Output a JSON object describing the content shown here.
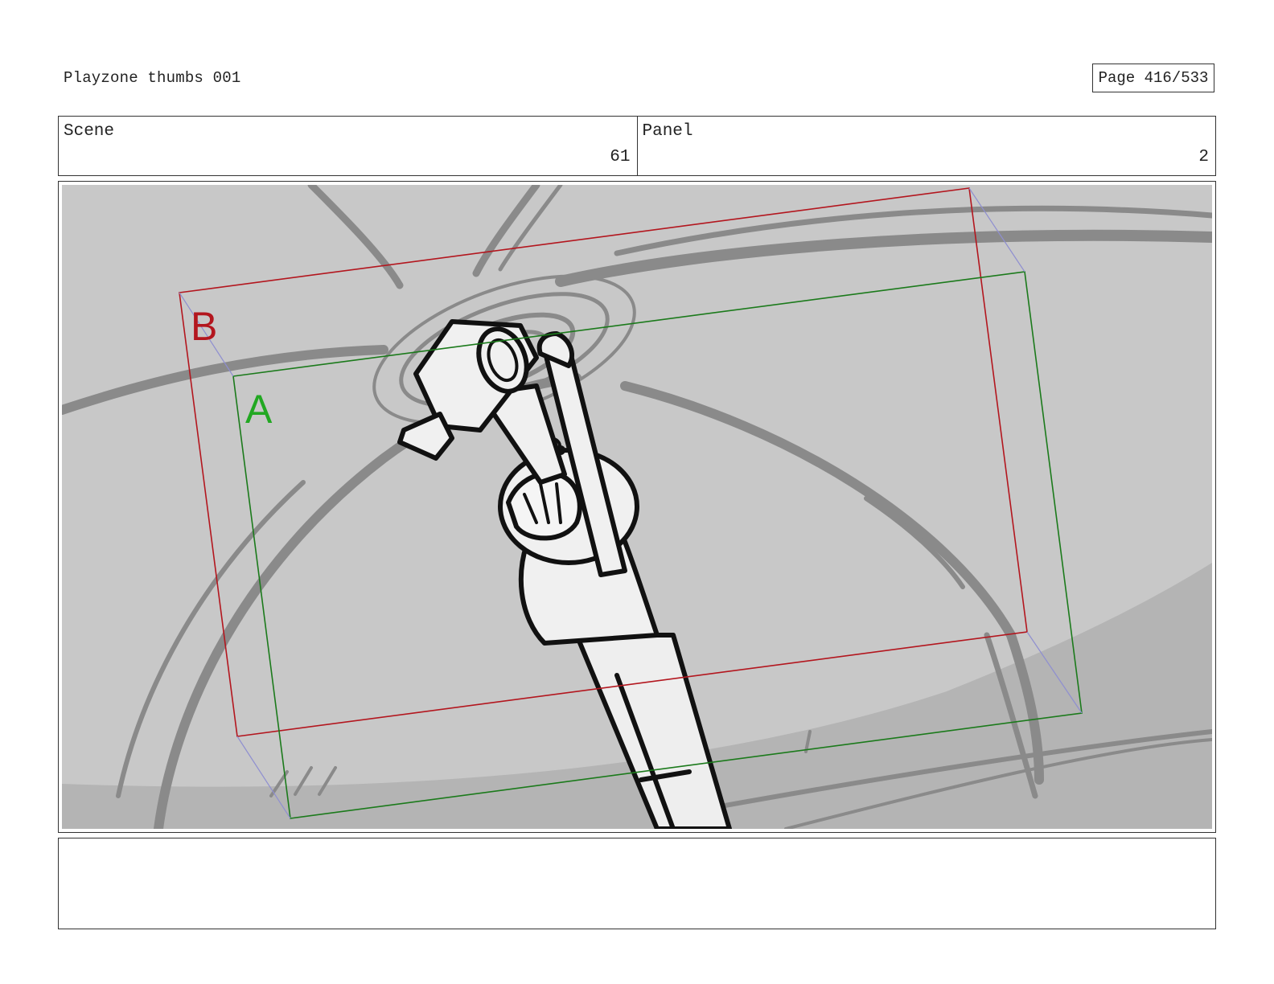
{
  "header": {
    "doc_title": "Playzone thumbs 001",
    "page_label": "Page 416/533"
  },
  "scene": {
    "label": "Scene",
    "value": "61"
  },
  "panel": {
    "label": "Panel",
    "value": "2"
  },
  "frame_labels": {
    "a": "A",
    "b": "B"
  },
  "colors": {
    "frame_a": "#1b7a1b",
    "frame_b": "#b3161e",
    "label_a": "#22a822",
    "label_b": "#b3161e",
    "background_sketch": "#c8c8c8",
    "sketch_lines": "#8a8a8a"
  },
  "notes": {
    "text": ""
  }
}
